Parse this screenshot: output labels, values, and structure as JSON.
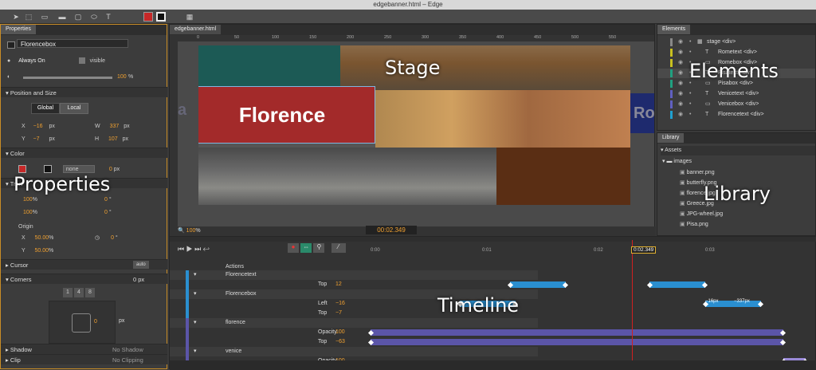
{
  "window": {
    "title": "edgebanner.html – Edge"
  },
  "toolbar": {
    "icons": [
      "select-arrow",
      "transform-tool",
      "clipping-tool",
      "rectangle-tool",
      "rounded-rectangle-tool",
      "ellipse-tool",
      "text-tool",
      "fill-color",
      "border-color",
      "keyframe-tool"
    ]
  },
  "properties": {
    "tab": "Properties",
    "element_name": "Florencebox",
    "always_on": "Always On",
    "visible": "visible",
    "opacity": "100",
    "opacity_unit": "%",
    "section_position": "Position and Size",
    "global": "Global",
    "local": "Local",
    "x_label": "X",
    "x": "−16",
    "x_unit": "px",
    "y_label": "Y",
    "y": "−7",
    "y_unit": "px",
    "w_label": "W",
    "w": "337",
    "w_unit": "px",
    "h_label": "H",
    "h": "107",
    "h_unit": "px",
    "section_color": "Color",
    "border_style": "none",
    "border_width": "0",
    "border_unit": "px",
    "section_transform": "Tran",
    "scale_x": "100",
    "scale_y": "100",
    "skew_x": "0",
    "skew_y": "0",
    "origin": "Origin",
    "origin_x_label": "X",
    "origin_x": "50.00",
    "origin_y_label": "Y",
    "origin_y": "50.00",
    "rotate": "0",
    "deg": "°",
    "pct": "%",
    "section_cursor": "Cursor",
    "cursor_value": "auto",
    "section_corners": "Corners",
    "corners_value": "0 px",
    "corner_presets": [
      "1",
      "4",
      "8"
    ],
    "corner_radius": "0",
    "corner_unit": "px",
    "section_shadow": "Shadow",
    "shadow_value": "No Shadow",
    "section_clip": "Clip",
    "clip_value": "No Clipping",
    "overlay_label": "Properties"
  },
  "stage": {
    "tab": "edgebanner.html",
    "ruler_ticks": [
      "0",
      "50",
      "100",
      "150",
      "200",
      "250",
      "300",
      "350",
      "400",
      "450",
      "500",
      "550"
    ],
    "florence_text": "Florence",
    "zoom": "100",
    "zoom_unit": "%",
    "left_letter": "a",
    "right_letter": "Ro",
    "overlay_label": "Stage"
  },
  "elements": {
    "tab": "Elements",
    "items": [
      {
        "name": "stage <div>",
        "color": "#888888"
      },
      {
        "name": "Rometext <div>",
        "color": "#c8c020"
      },
      {
        "name": "Romebox <div>",
        "color": "#c8c020"
      },
      {
        "name": "Pisatext <div>",
        "color": "#20a080"
      },
      {
        "name": "Pisabox <div>",
        "color": "#20a080"
      },
      {
        "name": "Venicetext <div>",
        "color": "#6060c0"
      },
      {
        "name": "Venicebox <div>",
        "color": "#6060c0"
      },
      {
        "name": "Florencetext <div>",
        "color": "#20a0d0"
      }
    ],
    "overlay_label": "Elements"
  },
  "library": {
    "tab": "Library",
    "assets": "Assets",
    "folder": "images",
    "files": [
      "banner.png",
      "butterfly.png",
      "florence.jpg",
      "Greece.jpg",
      "JPG-wheel.jpg",
      "Pisa.png"
    ],
    "overlay_label": "Library"
  },
  "timeline": {
    "time": "00:02.349",
    "playhead_time": "0:02.349",
    "actions": "Actions",
    "ticks": [
      "0:00",
      "0:01",
      "0:02",
      "0:03"
    ],
    "overlay_label": "Timeline",
    "rows": [
      {
        "name": "Florencetext",
        "type": "element"
      },
      {
        "name": "Top",
        "value": "12",
        "type": "prop"
      },
      {
        "name": "Florencebox",
        "type": "element"
      },
      {
        "name": "Left",
        "value": "−16",
        "type": "prop"
      },
      {
        "name": "Top",
        "value": "−7",
        "type": "prop"
      },
      {
        "name": "florence",
        "type": "element"
      },
      {
        "name": "Opacity",
        "value": "100",
        "type": "prop"
      },
      {
        "name": "Top",
        "value": "−63",
        "type": "prop"
      },
      {
        "name": "venice",
        "type": "element"
      },
      {
        "name": "Opacity",
        "value": "100",
        "type": "prop"
      }
    ],
    "bar_labels": {
      "left_start": "-337px",
      "left_a": "−16px",
      "left_b": "−337px"
    }
  },
  "colors": {
    "accent_orange": "#f0a030",
    "stage_red": "#a32a2a",
    "teal": "#1c5a55",
    "brown": "#5a2e14",
    "timeline_blue": "#2a8fd0",
    "timeline_purple": "#5b55a8"
  }
}
